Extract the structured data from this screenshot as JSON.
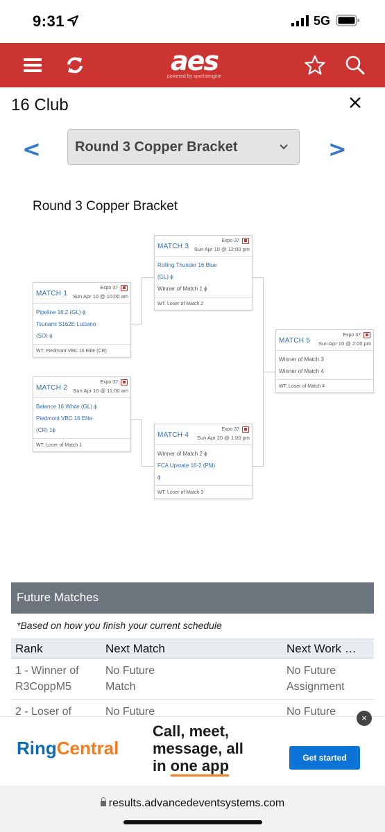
{
  "status_bar": {
    "time": "9:31",
    "network": "5G"
  },
  "nav": {
    "logo_text": "aes",
    "logo_subtext": "powered by sportsengine",
    "icons": [
      "menu-icon",
      "refresh-icon",
      "star-icon",
      "search-icon"
    ]
  },
  "page": {
    "club_title": "16 Club",
    "round_select_value": "Round 3 Copper Bracket",
    "prev_label": "<",
    "next_label": ">",
    "bracket_title": "Round 3 Copper Bracket"
  },
  "matches": {
    "m1": {
      "label": "MATCH 1",
      "court": "Expo 37",
      "time": "Sun Apr 10 @ 10:00 am",
      "team1": "Pipeline 16.2 (GL) ϕ",
      "team2a": "Tsunami S162E Luciano",
      "team2b": "(SO) ϕ",
      "wt": "WT: Piedmont VBC 16 Elite (CR)"
    },
    "m2": {
      "label": "MATCH 2",
      "court": "Expo 37",
      "time": "Sun Apr 10 @ 11:00 am",
      "team1": "Balance 16 White (GL) ϕ",
      "team2a": "Piedmont VBC 16 Elite",
      "team2b": "(CR) 1ϕ",
      "wt": "WT: Loser of Match 1"
    },
    "m3": {
      "label": "MATCH 3",
      "court": "Expo 37",
      "time": "Sun Apr 10 @ 12:00 pm",
      "team1a": "Rolling Thunder 16 Blue",
      "team1b": "(GL) ϕ",
      "team2": "Winner of Match 1 ϕ",
      "wt": "WT: Loser of Match 2"
    },
    "m4": {
      "label": "MATCH 4",
      "court": "Expo 37",
      "time": "Sun Apr 10 @ 1:00 pm",
      "team1": "Winner of Match 2 ϕ",
      "team2a": "FCA Upstate 16-2 (PM)",
      "team2b": "ϕ",
      "wt": "WT: Loser of Match 3"
    },
    "m5": {
      "label": "MATCH 5",
      "court": "Expo 37",
      "time": "Sun Apr 10 @ 2:00 pm",
      "team1": "Winner of Match 3",
      "team2": "Winner of Match 4",
      "wt": "WT: Loser of Match 4"
    }
  },
  "future": {
    "heading": "Future Matches",
    "note": "*Based on how you finish your current schedule",
    "columns": [
      "Rank",
      "Next Match",
      "Next Work …"
    ],
    "rows": [
      {
        "rank_a": "1 - Winner of",
        "rank_b": "R3CoppM5",
        "next_a": "No Future",
        "next_b": "Match",
        "work_a": "No Future",
        "work_b": "Assignment"
      },
      {
        "rank_a": "2 - Loser of",
        "rank_b": "",
        "next_a": "No Future",
        "next_b": "",
        "work_a": "No Future",
        "work_b": ""
      }
    ]
  },
  "ad": {
    "brand_ring": "Ring",
    "brand_central": "Central",
    "line1": "Call, meet,",
    "line2": "message, all",
    "line3_a": "in ",
    "line3_b": "one app",
    "cta": "Get started",
    "close": "×"
  },
  "browser": {
    "url": "results.advancedeventsystems.com"
  }
}
